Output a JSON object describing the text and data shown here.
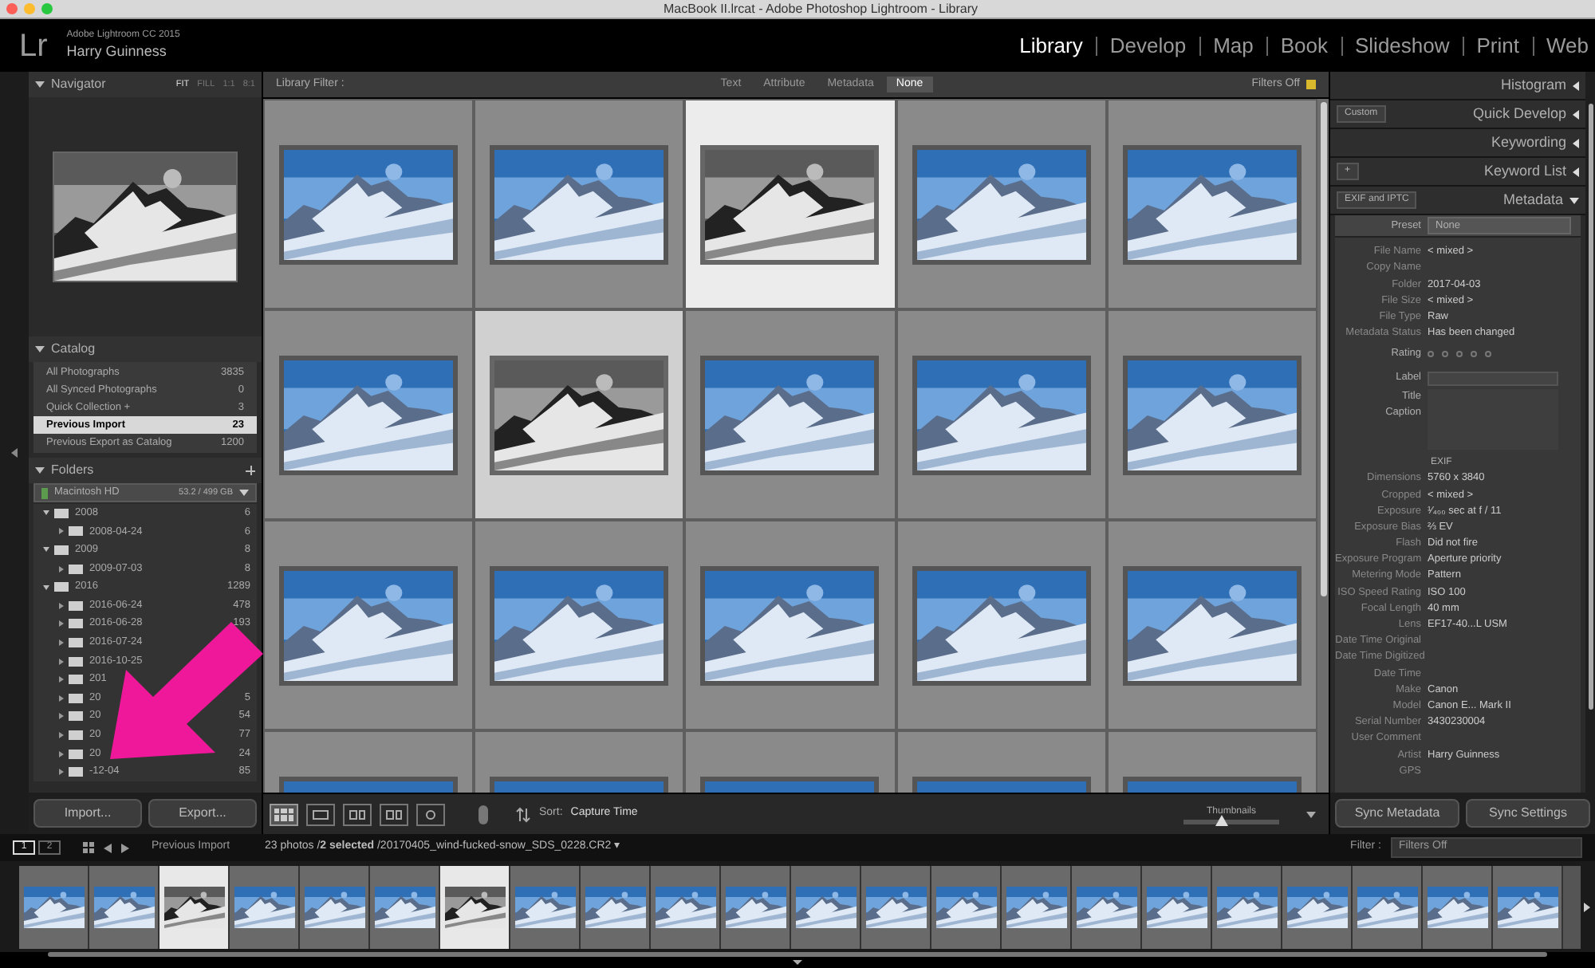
{
  "window": {
    "title": "MacBook II.lrcat - Adobe Photoshop Lightroom - Library"
  },
  "identity": {
    "logo": "Lr",
    "product": "Adobe Lightroom CC 2015",
    "user": "Harry Guinness"
  },
  "modules": [
    {
      "label": "Library",
      "selected": true
    },
    {
      "label": "Develop",
      "selected": false
    },
    {
      "label": "Map",
      "selected": false
    },
    {
      "label": "Book",
      "selected": false
    },
    {
      "label": "Slideshow",
      "selected": false
    },
    {
      "label": "Print",
      "selected": false
    },
    {
      "label": "Web",
      "selected": false
    }
  ],
  "navigator": {
    "title": "Navigator",
    "zoom": [
      {
        "label": "FIT",
        "selected": true
      },
      {
        "label": "FILL",
        "selected": false
      },
      {
        "label": "1:1",
        "selected": false
      },
      {
        "label": "8:1",
        "selected": false
      }
    ]
  },
  "catalog": {
    "title": "Catalog",
    "items": [
      {
        "label": "All Photographs",
        "count": "3835",
        "selected": false
      },
      {
        "label": "All Synced Photographs",
        "count": "0",
        "selected": false
      },
      {
        "label": "Quick Collection +",
        "count": "3",
        "selected": false
      },
      {
        "label": "Previous Import",
        "count": "23",
        "selected": true
      },
      {
        "label": "Previous Export as Catalog",
        "count": "1200",
        "selected": false
      }
    ]
  },
  "folders": {
    "title": "Folders",
    "volume": {
      "name": "Macintosh HD",
      "space": "53.2 / 499 GB"
    },
    "tree": [
      {
        "name": "2008",
        "count": "6",
        "expanded": true,
        "children": [
          {
            "name": "2008-04-24",
            "count": "6",
            "expanded": false
          }
        ]
      },
      {
        "name": "2009",
        "count": "8",
        "expanded": true,
        "children": [
          {
            "name": "2009-07-03",
            "count": "8",
            "expanded": false
          }
        ]
      },
      {
        "name": "2016",
        "count": "1289",
        "expanded": true,
        "children": [
          {
            "name": "2016-06-24",
            "count": "478",
            "expanded": false
          },
          {
            "name": "2016-06-28",
            "count": "193",
            "expanded": false
          },
          {
            "name": "2016-07-24",
            "expanded": false
          },
          {
            "name": "2016-10-25",
            "expanded": false
          },
          {
            "name": "201",
            "expanded": false
          },
          {
            "name": "20",
            "count": "5",
            "expanded": false
          },
          {
            "name": "20",
            "count": "54",
            "expanded": false
          },
          {
            "name": "20",
            "count": "77",
            "expanded": false
          },
          {
            "name": "20",
            "count": "24",
            "expanded": false
          },
          {
            "name": "-12-04",
            "count": "85",
            "expanded": false
          }
        ]
      }
    ]
  },
  "left_buttons": [
    "Import...",
    "Export..."
  ],
  "library_filter": {
    "label": "Library Filter :",
    "tabs": [
      {
        "label": "Text",
        "selected": false
      },
      {
        "label": "Attribute",
        "selected": false
      },
      {
        "label": "Metadata",
        "selected": false
      },
      {
        "label": "None",
        "selected": true
      }
    ],
    "status": "Filters Off"
  },
  "grid": [
    {
      "grayscale": false,
      "selected": false
    },
    {
      "grayscale": false,
      "selected": false
    },
    {
      "grayscale": true,
      "selected": true
    },
    {
      "grayscale": false,
      "selected": false
    },
    {
      "grayscale": false,
      "selected": false
    },
    {
      "grayscale": false,
      "selected": false
    },
    {
      "grayscale": true,
      "selected": true
    },
    {
      "grayscale": false,
      "selected": false
    },
    {
      "grayscale": false,
      "selected": false
    },
    {
      "grayscale": false,
      "selected": false
    },
    {
      "grayscale": false,
      "selected": false
    },
    {
      "grayscale": false,
      "selected": false
    },
    {
      "grayscale": false,
      "selected": false
    },
    {
      "grayscale": false,
      "selected": false
    },
    {
      "grayscale": false,
      "selected": false
    },
    {
      "grayscale": false,
      "selected": false
    },
    {
      "grayscale": false,
      "selected": false
    },
    {
      "grayscale": false,
      "selected": false
    },
    {
      "grayscale": false,
      "selected": false
    },
    {
      "grayscale": false,
      "selected": false
    }
  ],
  "toolbar": {
    "sort_label": "Sort:",
    "sort_value": "Capture Time",
    "thumbnails_label": "Thumbnails",
    "thumbnails": {
      "level": 0.4
    }
  },
  "right_panels": [
    {
      "title": "Histogram",
      "expanded": false
    },
    {
      "title": "Quick Develop",
      "dropdown": "Custom",
      "expanded": false
    },
    {
      "title": "Keywording",
      "expanded": false
    },
    {
      "title": "Keyword List",
      "dropdown": "+",
      "expanded": false
    },
    {
      "title": "Metadata",
      "dropdown": "EXIF and IPTC",
      "expanded": true
    }
  ],
  "metadata": {
    "preset_label": "Preset",
    "preset": "None",
    "rating_label": "Rating",
    "stars": 0,
    "fields": [
      {
        "label": "File Name",
        "value": "< mixed >"
      },
      {
        "label": "Copy Name"
      },
      {
        "label": "Folder",
        "value": "2017-04-03"
      },
      {
        "label": "File Size",
        "value": "< mixed >"
      },
      {
        "label": "File Type",
        "value": "Raw"
      },
      {
        "label": "Metadata Status",
        "value": "Has been changed"
      }
    ],
    "label_label": "Label",
    "title_label": "Title",
    "caption_label": "Caption",
    "section": "EXIF",
    "exif": [
      {
        "label": "Dimensions",
        "value": "5760 x 3840"
      },
      {
        "label": "Cropped",
        "value": "< mixed >"
      },
      {
        "label": "Exposure",
        "value": "¹⁄₄₀₀ sec at f / 11"
      },
      {
        "label": "Exposure Bias",
        "value": "⅔ EV"
      },
      {
        "label": "Flash",
        "value": "Did not fire"
      },
      {
        "label": "Exposure Program",
        "value": "Aperture priority"
      },
      {
        "label": "Metering Mode",
        "value": "Pattern"
      },
      {
        "label": "ISO Speed Rating",
        "value": "ISO 100"
      },
      {
        "label": "Focal Length",
        "value": "40 mm"
      },
      {
        "label": "Lens",
        "value": "EF17-40...L USM"
      },
      {
        "label": "Date Time Original"
      },
      {
        "label": "Date Time Digitized"
      },
      {
        "label": "Date Time"
      },
      {
        "label": "Make",
        "value": "Canon"
      },
      {
        "label": "Model",
        "value": "Canon E... Mark II"
      },
      {
        "label": "Serial Number",
        "value": "3430230004"
      },
      {
        "label": "User Comment"
      },
      {
        "label": "Artist",
        "value": "Harry Guinness"
      },
      {
        "label": "GPS"
      }
    ]
  },
  "right_buttons": [
    "Sync Metadata",
    "Sync Settings"
  ],
  "filmstrip": {
    "pages": [
      {
        "label": "1",
        "selected": true
      },
      {
        "label": "2",
        "selected": false
      }
    ],
    "source": "Previous Import",
    "info": "23 photos /**2 selected** /20170405_wind-fucked-snow_SDS_0228.CR2 ▾",
    "filter_label": "Filter :",
    "filter": "Filters Off",
    "thumbs": [
      {
        "grayscale": false,
        "selected": false
      },
      {
        "grayscale": false,
        "selected": false
      },
      {
        "grayscale": true,
        "selected": true
      },
      {
        "grayscale": false,
        "selected": false
      },
      {
        "grayscale": false,
        "selected": false
      },
      {
        "grayscale": false,
        "selected": false
      },
      {
        "grayscale": true,
        "selected": true
      },
      {
        "grayscale": false,
        "selected": false
      },
      {
        "grayscale": false,
        "selected": false
      },
      {
        "grayscale": false,
        "selected": false
      },
      {
        "grayscale": false,
        "selected": false
      },
      {
        "grayscale": false,
        "selected": false
      },
      {
        "grayscale": false,
        "selected": false
      },
      {
        "grayscale": false,
        "selected": false
      },
      {
        "grayscale": false,
        "selected": false
      },
      {
        "grayscale": false,
        "selected": false
      },
      {
        "grayscale": false,
        "selected": false
      },
      {
        "grayscale": false,
        "selected": false
      },
      {
        "grayscale": false,
        "selected": false
      },
      {
        "grayscale": false,
        "selected": false
      },
      {
        "grayscale": false,
        "selected": false
      },
      {
        "grayscale": false,
        "selected": false
      }
    ]
  }
}
